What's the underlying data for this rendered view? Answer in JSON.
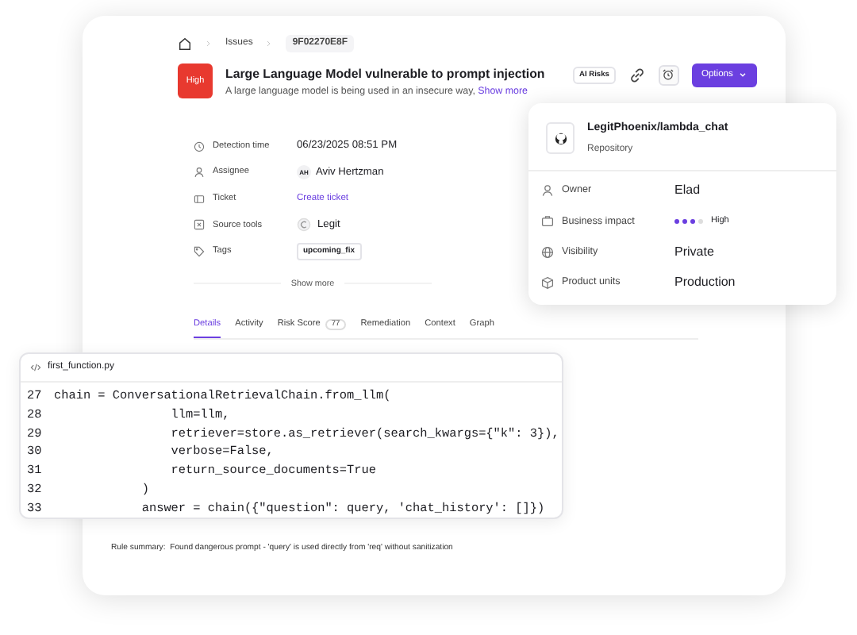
{
  "breadcrumb": [
    "Issues",
    "9F02270E8F"
  ],
  "issue": {
    "severity": "High",
    "title": "Large Language Model vulnerable to prompt injection",
    "description": "A large language model is being used in an insecure way,",
    "show_more": "Show more",
    "badge": "AI Risks",
    "options_button": "Options"
  },
  "details": [
    {
      "label": "Detection time",
      "kind": "text",
      "value": "06/23/2025 08:51 PM"
    },
    {
      "label": "Assignee",
      "kind": "person",
      "initials": "AH",
      "value": "Aviv Hertzman"
    },
    {
      "label": "Ticket",
      "kind": "link",
      "value": "Create ticket"
    },
    {
      "label": "Source tools",
      "kind": "tool",
      "value": "Legit"
    },
    {
      "label": "Tags",
      "kind": "tag",
      "value": "upcoming_fix"
    }
  ],
  "show_more": "Show more",
  "tabs": [
    {
      "label": "Details",
      "selected": true
    },
    {
      "label": "Activity",
      "selected": false
    },
    {
      "label": "Risk Score",
      "count": "77",
      "selected": false
    },
    {
      "label": "Remediation",
      "selected": false
    },
    {
      "label": "Context",
      "selected": false
    },
    {
      "label": "Graph",
      "selected": false
    }
  ],
  "repository": {
    "name": "LegitPhoenix/lambda_chat",
    "type": "Repository",
    "fields": [
      {
        "label": "Owner",
        "kind": "text",
        "value": "Elad"
      },
      {
        "label": "Business impact",
        "kind": "rating",
        "stars": 3,
        "value": "High"
      },
      {
        "label": "Visibility",
        "kind": "text",
        "value": "Private"
      },
      {
        "label": "Product units",
        "kind": "text",
        "value": "Production"
      }
    ]
  },
  "code": {
    "filename": "first_function.py",
    "lines": [
      {
        "number": "27",
        "text": "chain = ConversationalRetrievalChain.from_llm("
      },
      {
        "number": "28",
        "text": "                llm=llm,"
      },
      {
        "number": "29",
        "text": "                retriever=store.as_retriever(search_kwargs={\"k\": 3}),"
      },
      {
        "number": "30",
        "text": "                verbose=False,"
      },
      {
        "number": "31",
        "text": "                return_source_documents=True"
      },
      {
        "number": "32",
        "text": "            )"
      },
      {
        "number": "33",
        "text": "            answer = chain({\"question\": query, 'chat_history': []})"
      }
    ]
  },
  "rule_summary": {
    "label": "Rule summary:",
    "text": "Found dangerous prompt - 'query' is used directly from 'req' without sanitization"
  }
}
